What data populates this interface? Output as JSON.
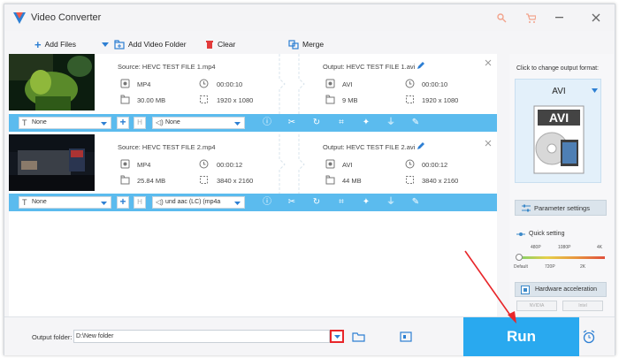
{
  "window": {
    "title": "Video Converter"
  },
  "toolbar": {
    "add_files": "Add Files",
    "add_video_folder": "Add Video Folder",
    "clear": "Clear",
    "merge": "Merge"
  },
  "files": [
    {
      "source": "Source: HEVC TEST FILE 1.mp4",
      "src_format": "MP4",
      "src_duration": "00:00:10",
      "src_size": "30.00 MB",
      "src_resolution": "1920 x 1080",
      "output": "Output: HEVC TEST FILE 1.avi",
      "out_format": "AVI",
      "out_duration": "00:00:10",
      "out_size": "9 MB",
      "out_resolution": "1920 x 1080",
      "subtitle": "None",
      "audio": "None"
    },
    {
      "source": "Source: HEVC TEST FILE 2.mp4",
      "src_format": "MP4",
      "src_duration": "00:00:12",
      "src_size": "25.84 MB",
      "src_resolution": "3840 x 2160",
      "output": "Output: HEVC TEST FILE 2.avi",
      "out_format": "AVI",
      "out_duration": "00:00:12",
      "out_size": "44 MB",
      "out_resolution": "3840 x 2160",
      "subtitle": "None",
      "audio": "und aac (LC) (mp4a"
    }
  ],
  "panel": {
    "click_to_change": "Click to change output format:",
    "format": "AVI",
    "format_badge": "AVI",
    "parameter_settings": "Parameter settings",
    "quick_setting": "Quick setting",
    "quality_top": [
      "480P",
      "1080P",
      "4K"
    ],
    "quality_bottom": [
      "Default",
      "720P",
      "2K"
    ],
    "hardware_acceleration": "Hardware acceleration",
    "nvidia": "NVIDIA",
    "intel": "Intel"
  },
  "bottom": {
    "output_folder_label": "Output folder:",
    "output_folder_value": "D:\\New folder",
    "run": "Run"
  },
  "colors": {
    "accent": "#29a9ef",
    "bar": "#5bbbee",
    "annotation": "#e8262a"
  }
}
